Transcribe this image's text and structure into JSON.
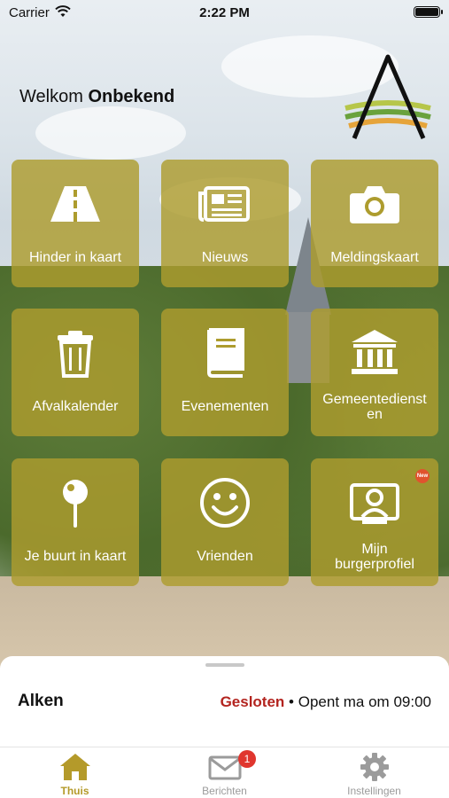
{
  "status_bar": {
    "carrier": "Carrier",
    "time": "2:22 PM"
  },
  "header": {
    "welcome": "Welkom",
    "user": "Onbekend"
  },
  "tiles": [
    {
      "label": "Hinder in kaart",
      "icon": "road-icon"
    },
    {
      "label": "Nieuws",
      "icon": "newspaper-icon"
    },
    {
      "label": "Meldingskaart",
      "icon": "camera-icon"
    },
    {
      "label": "Afvalkalender",
      "icon": "trash-icon"
    },
    {
      "label": "Evenementen",
      "icon": "book-icon"
    },
    {
      "label": "Gemeentediensten",
      "label_line1": "Gemeentedienst",
      "label_line2": "en",
      "icon": "bank-icon"
    },
    {
      "label": "Je buurt in kaart",
      "icon": "map-pin-icon"
    },
    {
      "label": "Vrienden",
      "icon": "smiley-icon"
    },
    {
      "label": "Mijn burgerprofiel",
      "label_line1": "Mijn",
      "label_line2": "burgerprofiel",
      "icon": "profile-card-icon",
      "badge": "New"
    }
  ],
  "location": {
    "name": "Alken",
    "status": "Gesloten",
    "opens": "Opent ma om 09:00"
  },
  "tabs": [
    {
      "label": "Thuis",
      "icon": "home-icon",
      "active": true
    },
    {
      "label": "Berichten",
      "icon": "mail-icon",
      "badge": "1"
    },
    {
      "label": "Instellingen",
      "icon": "gear-icon"
    }
  ],
  "colors": {
    "tile": "#ad9c2e",
    "accent": "#b49a2a",
    "closed": "#b3241f",
    "badge": "#e0362e"
  }
}
